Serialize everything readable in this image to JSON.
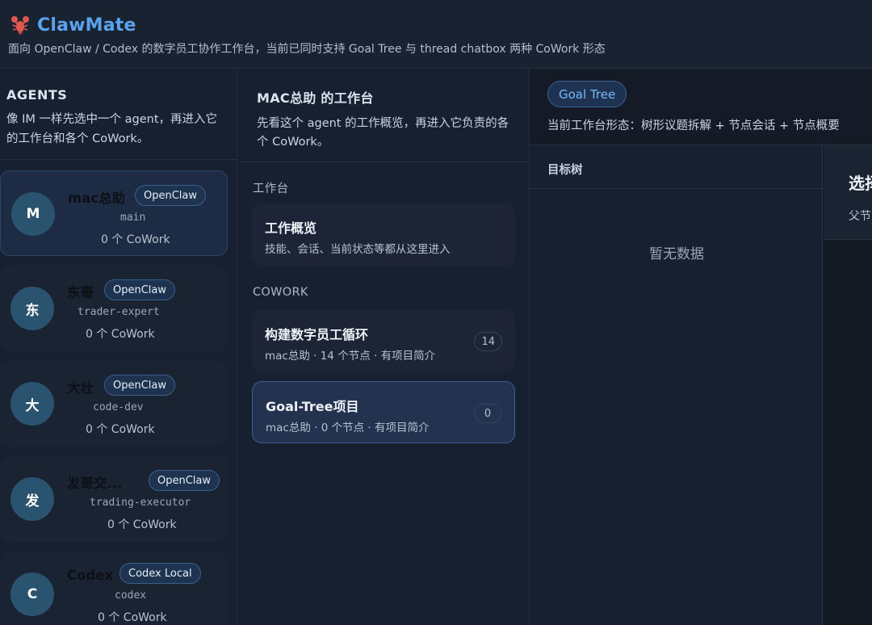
{
  "header": {
    "title": "ClawMate",
    "subtitle": "面向 OpenClaw / Codex 的数字员工协作工作台，当前已同时支持 Goal Tree 与 thread chatbox 两种 CoWork 形态"
  },
  "agents": {
    "title": "AGENTS",
    "description": "像 IM 一样先选中一个 agent，再进入它的工作台和各个 CoWork。",
    "items": [
      {
        "avatar": "M",
        "name": "mac总助",
        "tag": "OpenClaw",
        "id": "main",
        "count": "0 个 CoWork",
        "active": true
      },
      {
        "avatar": "东",
        "name": "东哥",
        "tag": "OpenClaw",
        "id": "trader-expert",
        "count": "0 个 CoWork"
      },
      {
        "avatar": "大",
        "name": "大壮",
        "tag": "OpenClaw",
        "id": "code-dev",
        "count": "0 个 CoWork"
      },
      {
        "avatar": "发",
        "name": "发哥交...",
        "tag": "OpenClaw",
        "id": "trading-executor",
        "count": "0 个 CoWork"
      },
      {
        "avatar": "C",
        "name": "Codex",
        "tag": "Codex Local",
        "id": "codex",
        "count": "0 个 CoWork"
      }
    ]
  },
  "workspace": {
    "title": "MAC总助 的工作台",
    "description": "先看这个 agent 的工作概览，再进入它负责的各个 CoWork。",
    "section_workbench": "工作台",
    "overview": {
      "title": "工作概览",
      "sub": "技能、会话、当前状态等都从这里进入"
    },
    "section_cowork": "COWORK",
    "coworks": [
      {
        "title": "构建数字员工循环",
        "sub": "mac总助 · 14 个节点 · 有项目简介",
        "count": "14"
      },
      {
        "title": "Goal-Tree项目",
        "sub": "mac总助 · 0 个节点 · 有项目简介",
        "count": "0",
        "active": true
      }
    ]
  },
  "right": {
    "mode": "Goal Tree",
    "mode_desc": "当前工作台形态：树形议题拆解 + 节点会话 + 节点概要",
    "tree_title": "目标树",
    "empty": "暂无数据",
    "detail_title": "选择",
    "detail_sub": "父节点"
  },
  "colors": {
    "accent": "#5aa2ee",
    "background": "#141b26",
    "panel": "#172030"
  }
}
